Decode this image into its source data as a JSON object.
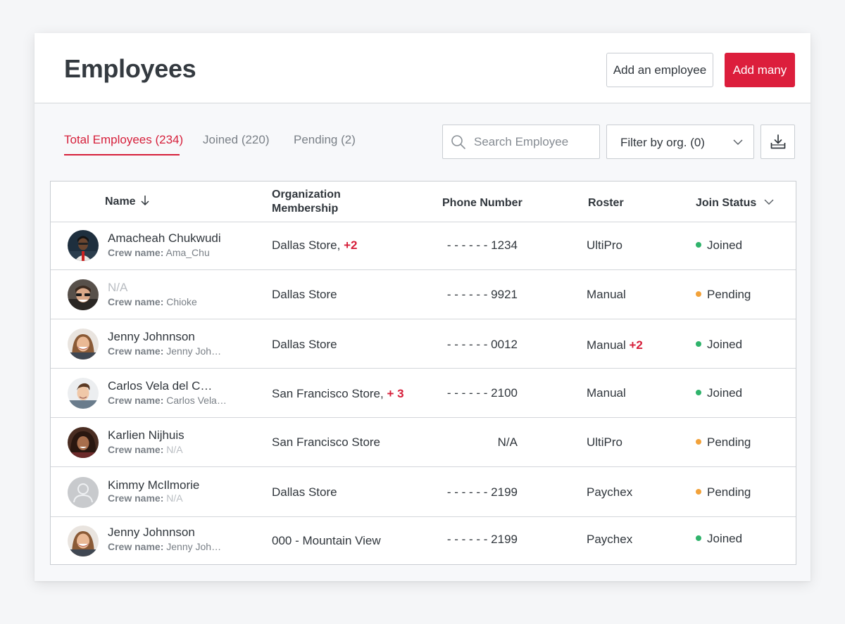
{
  "header": {
    "title": "Employees",
    "add_employee_label": "Add an employee",
    "add_many_label": "Add many"
  },
  "tabs": [
    {
      "label": "Total Employees (234)",
      "active": true
    },
    {
      "label": "Joined (220)",
      "active": false
    },
    {
      "label": "Pending (2)",
      "active": false
    }
  ],
  "search": {
    "placeholder": "Search Employee",
    "value": ""
  },
  "filter": {
    "label": "Filter by org. (0)"
  },
  "table": {
    "columns": {
      "name": "Name",
      "org_line1": "Organization",
      "org_line2": "Membership",
      "phone": "Phone Number",
      "roster": "Roster",
      "status": "Join Status"
    },
    "crew_label": "Crew name:",
    "rows": [
      {
        "name": "Amacheah Chukwudi",
        "crew": "Ama_Chu",
        "org": "Dallas Store,",
        "org_extra": "+2",
        "phone": "- - -  - - - 1234",
        "roster": "UltiPro",
        "roster_extra": "",
        "status": "Joined"
      },
      {
        "name": "N/A",
        "crew": "Chioke",
        "org": "Dallas Store",
        "org_extra": "",
        "phone": "- - -  - - - 9921",
        "roster": "Manual",
        "roster_extra": "",
        "status": "Pending"
      },
      {
        "name": "Jenny Johnnson",
        "crew": "Jenny Joh…",
        "org": "Dallas Store",
        "org_extra": "",
        "phone": "- - -  - - - 0012",
        "roster": "Manual",
        "roster_extra": "+2",
        "status": "Joined"
      },
      {
        "name": "Carlos Vela del C…",
        "crew": "Carlos Vela…",
        "org": "San Francisco Store,",
        "org_extra": "+ 3",
        "phone": "- - -  - - - 2100",
        "roster": "Manual",
        "roster_extra": "",
        "status": "Joined"
      },
      {
        "name": "Karlien Nijhuis",
        "crew": "N/A",
        "org": "San Francisco Store",
        "org_extra": "",
        "phone": "N/A",
        "roster": "UltiPro",
        "roster_extra": "",
        "status": "Pending"
      },
      {
        "name": "Kimmy McIlmorie",
        "crew": "N/A",
        "org": "Dallas Store",
        "org_extra": "",
        "phone": "- - -  - - - 2199",
        "roster": "Paychex",
        "roster_extra": "",
        "status": "Pending"
      },
      {
        "name": "Jenny Johnnson",
        "crew": "Jenny Joh…",
        "org": "000 - Mountain View",
        "org_extra": "",
        "phone": "- - -  - - - 2199",
        "roster": "Paychex",
        "roster_extra": "",
        "status": "Joined"
      }
    ]
  },
  "colors": {
    "accent": "#dc1e3c",
    "joined": "#2fb36b",
    "pending": "#f2a23a"
  }
}
